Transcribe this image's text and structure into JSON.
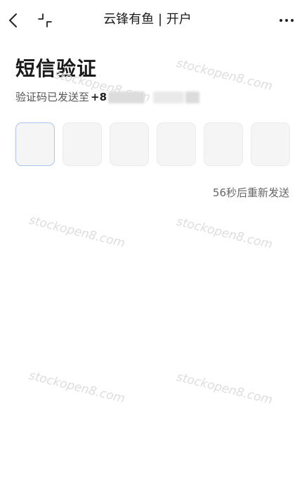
{
  "nav": {
    "title": "云锋有鱼 | 开户",
    "back_icon": "chevron-left-icon",
    "collapse_icon": "collapse-icon",
    "more_icon": "more-horizontal-icon"
  },
  "heading": "短信验证",
  "sent_message": "验证码已发送至",
  "phone_prefix": "+8",
  "code_boxes": [
    "",
    "",
    "",
    "",
    "",
    ""
  ],
  "resend_text": "56秒后重新发送",
  "watermark": "stockopen8.com",
  "colors": {
    "active_box_border": "#aac4ec",
    "box_fill": "#f5f5f5"
  }
}
